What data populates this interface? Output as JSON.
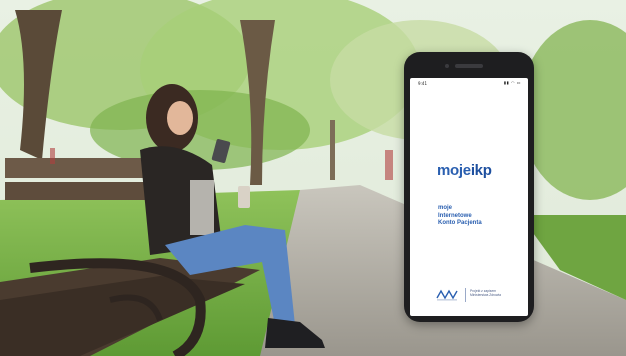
{
  "phone": {
    "status_time": "9:41",
    "status_icons": "▮▮ ◠ ▭"
  },
  "app": {
    "logo_main": "moje",
    "logo_accent": "ikp",
    "tagline_lines": [
      "moje",
      "Internetowe",
      "Konto Pacjenta"
    ],
    "footer_line1": "Projekt z zapisem",
    "footer_line2": "Ministerstwa Zdrowia"
  },
  "colors": {
    "brand_blue": "#2a5fb0",
    "phone_body": "#1e1e20"
  }
}
